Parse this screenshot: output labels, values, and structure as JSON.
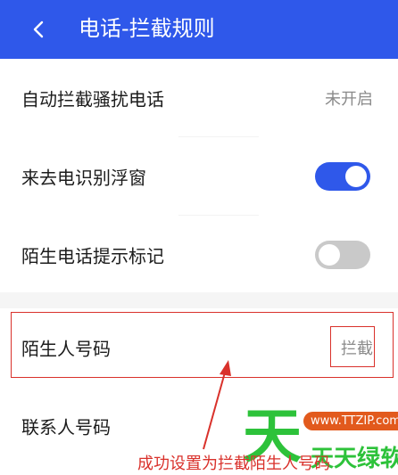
{
  "header": {
    "back_icon": "chevron-left-icon",
    "title": "电话-拦截规则",
    "background": "#2f58ea"
  },
  "settings": [
    {
      "label": "自动拦截骚扰电话",
      "value": "未开启"
    },
    {
      "label": "来去电识别浮窗",
      "toggle": "on"
    },
    {
      "label": "陌生电话提示标记",
      "toggle": "off"
    },
    {
      "label": "陌生人号码",
      "value": "拦截"
    },
    {
      "label": "联系人号码"
    }
  ],
  "annotation": {
    "text": "成功设置为拦截陌生人号码",
    "color": "#d9312b"
  },
  "watermark": {
    "big_char": "天",
    "url": "www.TTZIP.com",
    "name": "天天绿软"
  }
}
